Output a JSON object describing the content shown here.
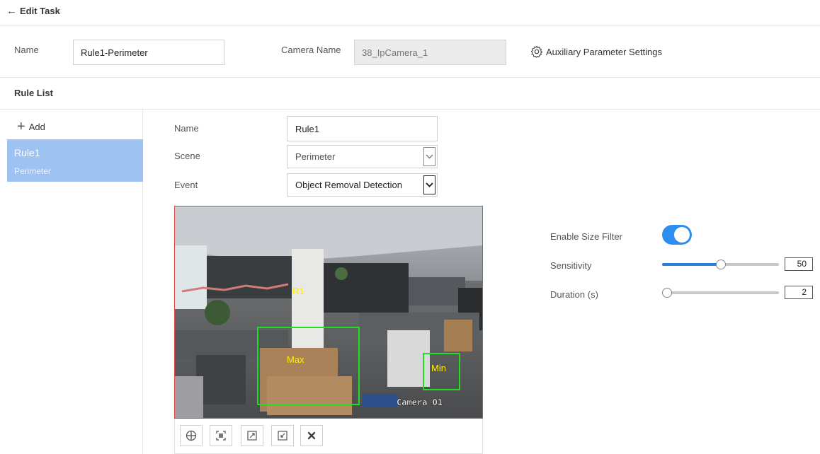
{
  "header": {
    "back_icon": "left-arrow-icon",
    "title": "Edit Task"
  },
  "task": {
    "name_label": "Name",
    "name_value": "Rule1-Perimeter",
    "camera_label": "Camera Name",
    "camera_value": "38_IpCamera_1",
    "aux_icon": "gear-icon",
    "aux_label": "Auxiliary Parameter Settings"
  },
  "rule_list": {
    "heading": "Rule List",
    "add_label": "Add",
    "items": [
      {
        "name": "Rule1",
        "scene": "Perimeter"
      }
    ]
  },
  "rule_form": {
    "name_label": "Name",
    "name_value": "Rule1",
    "scene_label": "Scene",
    "scene_value": "Perimeter",
    "event_label": "Event",
    "event_value": "Object Removal Detection"
  },
  "video": {
    "region_label": "R1",
    "max_label": "Max",
    "min_label": "Min",
    "camera_osd": "Camera 01",
    "overlay_color": "#22dd22",
    "label_color": "#ffee00"
  },
  "toolbar": {
    "buttons": [
      {
        "icon": "crosshair-target-icon"
      },
      {
        "icon": "fit-region-icon"
      },
      {
        "icon": "expand-max-icon"
      },
      {
        "icon": "shrink-min-icon"
      },
      {
        "icon": "clear-delete-icon"
      }
    ]
  },
  "settings": {
    "size_filter_label": "Enable Size Filter",
    "size_filter_enabled": true,
    "sensitivity_label": "Sensitivity",
    "sensitivity_value": "50",
    "sensitivity_fraction": 0.5,
    "duration_label": "Duration (s)",
    "duration_value": "2",
    "duration_fraction": 0.0
  },
  "colors": {
    "accent": "#2c8ff0",
    "selected_rule_bg": "#9ec3f3",
    "video_border": "#dd4444"
  }
}
